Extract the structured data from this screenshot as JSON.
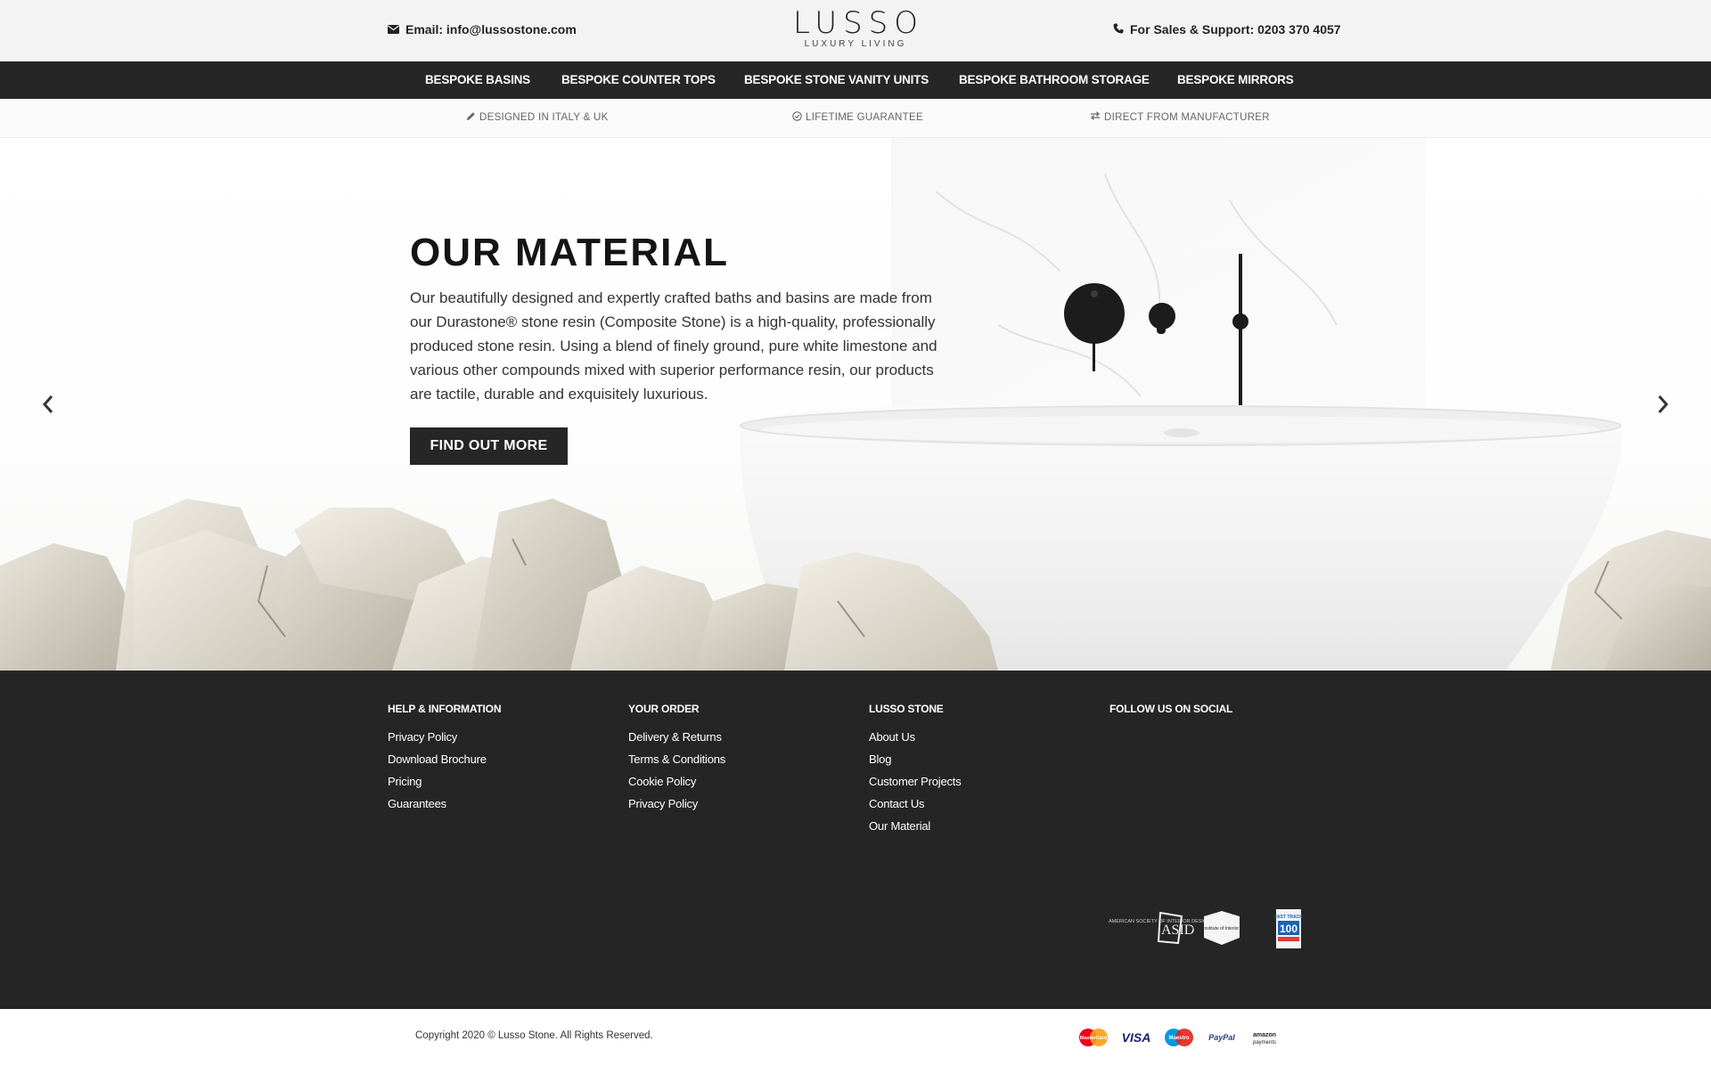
{
  "header": {
    "email_text": "Email: info@lussostone.com",
    "phone_text": "For Sales & Support: 0203 370 4057",
    "logo_name": "LUSSO",
    "logo_tagline": "LUXURY LIVING"
  },
  "nav": {
    "items": [
      {
        "label": "BESPOKE BASINS"
      },
      {
        "label": "BESPOKE COUNTER TOPS"
      },
      {
        "label": "BESPOKE STONE VANITY UNITS"
      },
      {
        "label": "BESPOKE BATHROOM STORAGE"
      },
      {
        "label": "BESPOKE MIRRORS"
      }
    ]
  },
  "usp": {
    "items": [
      {
        "label": "DESIGNED IN ITALY & UK",
        "icon": "pencil-icon"
      },
      {
        "label": "LIFETIME GUARANTEE",
        "icon": "check-circle-icon"
      },
      {
        "label": "DIRECT FROM MANUFACTURER",
        "icon": "exchange-icon"
      }
    ]
  },
  "hero": {
    "title": "OUR MATERIAL",
    "text": "Our beautifully designed and expertly crafted baths and basins are made from our Durastone® stone resin (Composite Stone) is a high-quality, professionally produced stone resin. Using a blend of finely ground, pure white limestone and various other compounds mixed with superior performance resin, our products are tactile, durable and exquisitely luxurious.",
    "button_label": "FIND OUT MORE"
  },
  "footer": {
    "columns": [
      {
        "heading": "HELP & INFORMATION",
        "links": [
          "Privacy Policy",
          "Download Brochure",
          "Pricing",
          "Guarantees"
        ]
      },
      {
        "heading": "YOUR ORDER",
        "links": [
          "Delivery & Returns",
          "Terms & Conditions",
          "Cookie Policy",
          "Privacy Policy"
        ]
      },
      {
        "heading": "LUSSO STONE",
        "links": [
          "About Us",
          "Blog",
          "Customer Projects",
          "Contact Us",
          "Our Material"
        ]
      },
      {
        "heading": "FOLLOW US ON SOCIAL",
        "links": []
      }
    ],
    "badges": {
      "asid_text": "AMERICAN SOCIETY OF INTERIOR DESIGNERS",
      "asid_mark": "ASID",
      "bild_text": "British Institute of Interior Design",
      "fast_track_top": "FAST TRACK",
      "fast_track_num": "100"
    }
  },
  "bottom": {
    "copyright": "Copyright 2020 © Lusso Stone. All Rights Reserved.",
    "payments": {
      "mastercard": "MasterCard",
      "visa": "VISA",
      "maestro": "Maestro",
      "paypal": "PayPal",
      "amazon_line1": "amazon",
      "amazon_line2": "payments"
    }
  },
  "colors": {
    "dark": "#262626",
    "topbar": "#f3f3f3",
    "footer": "#262525"
  }
}
